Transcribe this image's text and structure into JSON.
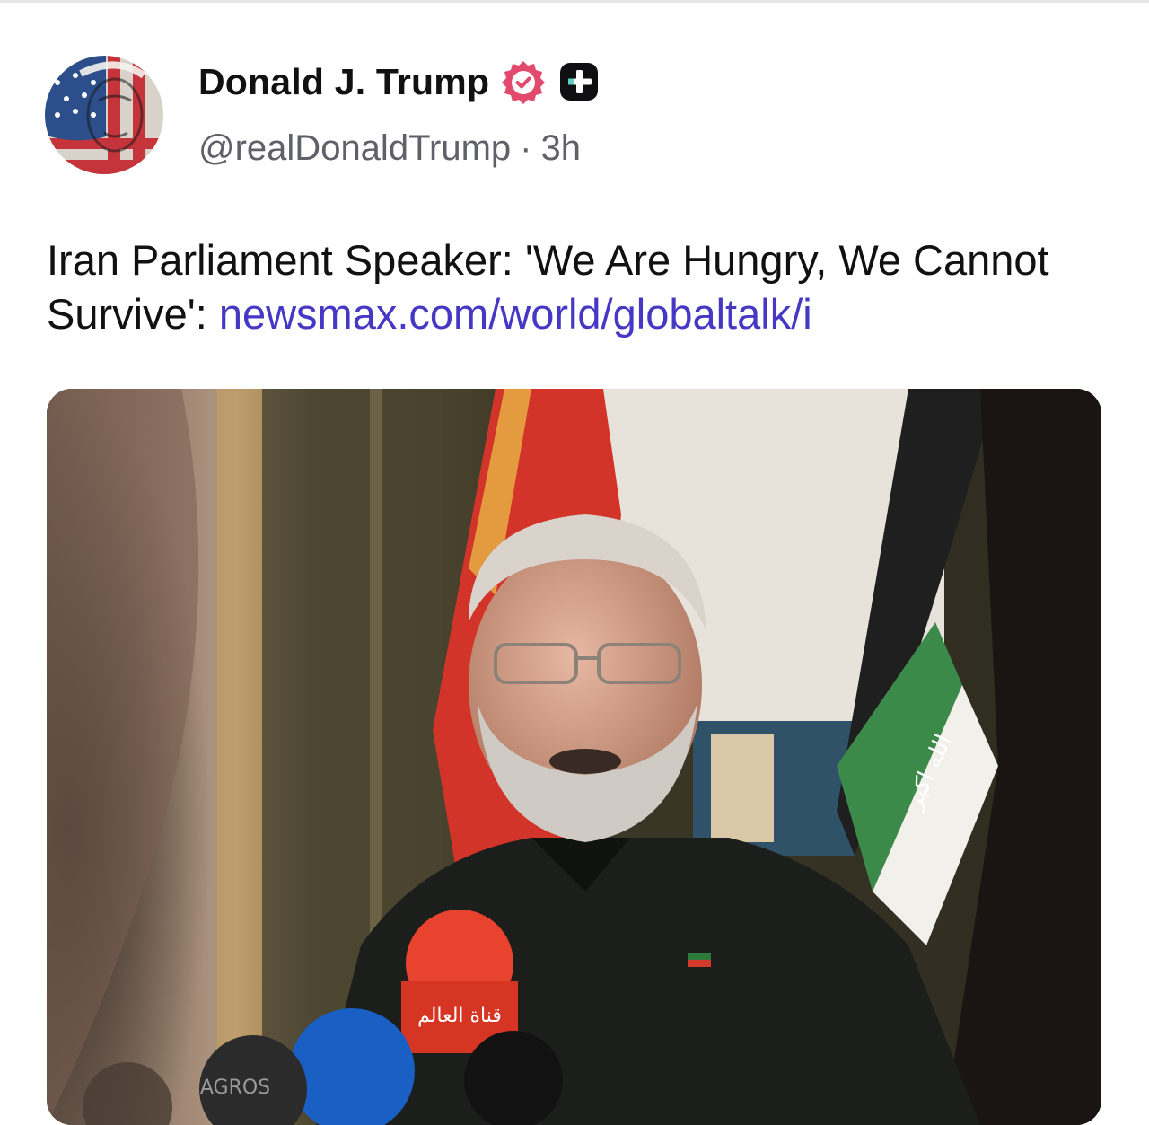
{
  "author": {
    "display_name": "Donald J. Trump",
    "handle": "@realDonaldTrump",
    "separator": "·",
    "time": "3h",
    "verified_icon": "verified-badge-icon",
    "plus_icon": "plus-square-icon"
  },
  "post": {
    "text": "Iran Parliament Speaker: 'We Are Hungry, We Cannot Survive':",
    "link": "newsmax.com/world/globaltalk/i"
  },
  "media": {
    "mic_label_1": "قناة العالم",
    "mic_label_2": "AGROS",
    "flag_script": "الله اكبر"
  },
  "colors": {
    "verified": "#e24a6d",
    "link": "#4638c4",
    "handle": "#606068"
  }
}
